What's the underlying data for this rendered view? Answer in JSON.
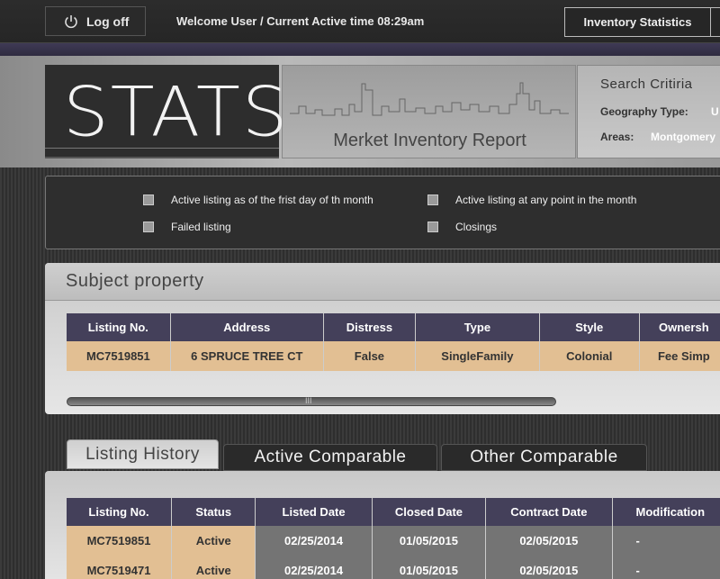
{
  "topbar": {
    "logoff_label": "Log off",
    "welcome_text": "Welcome User / Current Active time 08:29am",
    "inventory_button": "Inventory Statistics"
  },
  "header": {
    "stats_title": "STATS",
    "report_title": "Merket Inventory Report",
    "search": {
      "title": "Search Critiria",
      "geography_label": "Geography Type:",
      "geography_value": "U",
      "areas_label": "Areas:",
      "areas_value": "Montgomery"
    }
  },
  "legend": {
    "items": [
      "Active listing as of the frist day of th month",
      "Active listing at any point in the month",
      "Failed listing",
      "Closings"
    ]
  },
  "subject": {
    "title": "Subject property",
    "columns": [
      "Listing No.",
      "Address",
      "Distress",
      "Type",
      "Style",
      "Ownersh"
    ],
    "row": [
      "MC7519851",
      "6 SPRUCE TREE CT",
      "False",
      "SingleFamily",
      "Colonial",
      "Fee Simp"
    ],
    "scroll_grip": "III"
  },
  "tabs": [
    "Listing History",
    "Active Comparable",
    "Other Comparable"
  ],
  "history": {
    "columns": [
      "Listing No.",
      "Status",
      "Listed Date",
      "Closed Date",
      "Contract Date",
      "Modification"
    ],
    "rows": [
      [
        "MC7519851",
        "Active",
        "02/25/2014",
        "01/05/2015",
        "02/05/2015",
        "-"
      ],
      [
        "MC7519471",
        "Active",
        "02/25/2014",
        "01/05/2015",
        "02/05/2015",
        "-"
      ]
    ]
  },
  "colors": {
    "accent_purple": "#44405a",
    "row_tan": "#e2bf93",
    "row_gray": "#747474"
  }
}
